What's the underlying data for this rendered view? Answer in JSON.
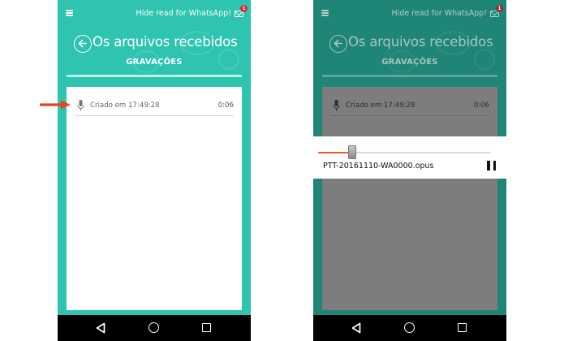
{
  "topbar": {
    "hide_read_label": "Hide read for WhatsApp!",
    "badge_count": "1"
  },
  "screen": {
    "title": "Os arquivos recebidos",
    "tab_label": "GRAVAÇÕES"
  },
  "recording": {
    "label": "Criado em 17:49:28",
    "duration": "0:06"
  },
  "player": {
    "file_name": "PTT-20161110-WA0000.opus",
    "progress": 0.2
  },
  "colors": {
    "app_teal": "#2ec4b0",
    "dimmed_teal": "#1f8577",
    "accent_orange": "#f05a2a",
    "annotation_arrow": "#e8441e",
    "badge_red": "#e0282e"
  }
}
